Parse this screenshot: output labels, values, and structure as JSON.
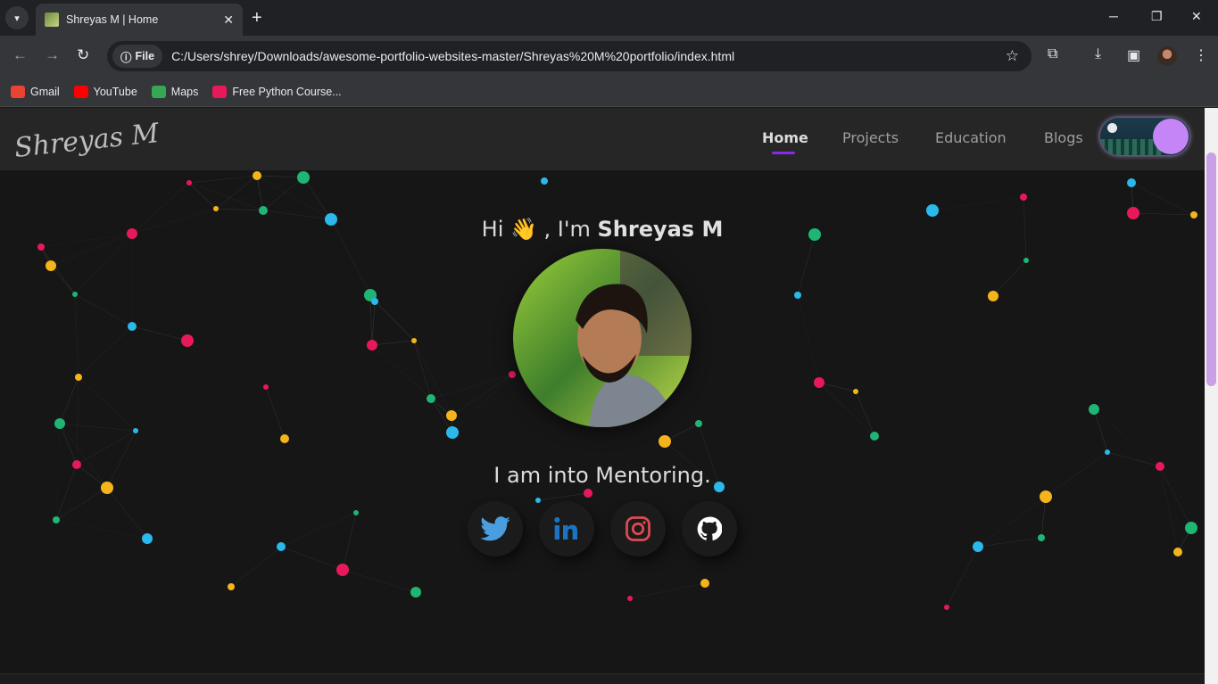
{
  "browser": {
    "tab_title": "Shreyas M | Home",
    "new_tab": "+",
    "address_chip": "File",
    "url": "C:/Users/shrey/Downloads/awesome-portfolio-websites-master/Shreyas%20M%20portfolio/index.html",
    "bookmarks": [
      {
        "label": "Gmail",
        "icon": "gmail-icon",
        "color": "#ea4335"
      },
      {
        "label": "YouTube",
        "icon": "youtube-icon",
        "color": "#ff0000"
      },
      {
        "label": "Maps",
        "icon": "maps-icon",
        "color": "#34a853"
      },
      {
        "label": "Free Python Course...",
        "icon": "python-course-icon",
        "color": "#e8195b"
      }
    ]
  },
  "site": {
    "logo_text": "Shreyas M",
    "nav": [
      {
        "label": "Home",
        "active": true
      },
      {
        "label": "Projects",
        "active": false
      },
      {
        "label": "Education",
        "active": false
      },
      {
        "label": "Blogs",
        "active": false
      }
    ],
    "greeting_prefix": "Hi",
    "greeting_emoji": "👋",
    "greeting_mid": ", I'm",
    "name": "Shreyas M",
    "tagline": "I am into Mentoring.",
    "social": [
      {
        "name": "twitter-icon",
        "color": "#1da1f2"
      },
      {
        "name": "linkedin-icon",
        "color": "#0a66c2"
      },
      {
        "name": "instagram-icon",
        "color": "#e1306c"
      },
      {
        "name": "github-icon",
        "color": "#ffffff"
      }
    ],
    "accent": "#8a2be2",
    "particle_colors": [
      "#e8195b",
      "#f4b41a",
      "#1fb574",
      "#2bb8ea"
    ]
  }
}
